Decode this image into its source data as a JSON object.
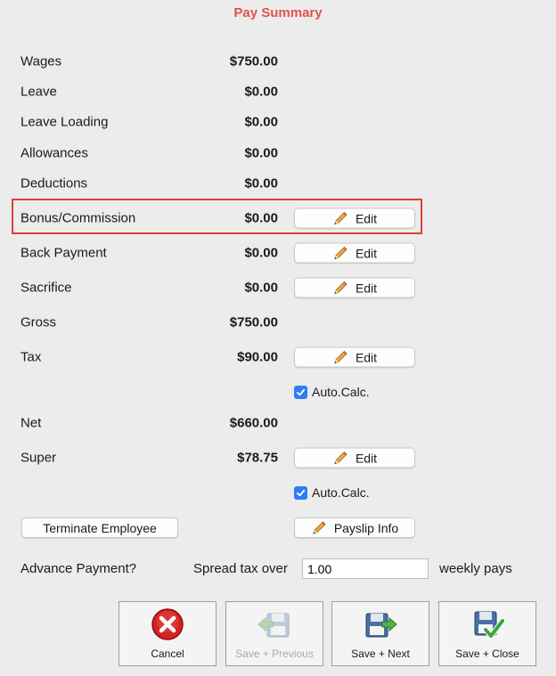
{
  "title": "Pay Summary",
  "rows": [
    {
      "label": "Wages",
      "amount": "$750.00"
    },
    {
      "label": "Leave",
      "amount": "$0.00"
    },
    {
      "label": "Leave Loading",
      "amount": "$0.00"
    },
    {
      "label": "Allowances",
      "amount": "$0.00"
    },
    {
      "label": "Deductions",
      "amount": "$0.00"
    },
    {
      "label": "Bonus/Commission",
      "amount": "$0.00"
    },
    {
      "label": "Back Payment",
      "amount": "$0.00"
    },
    {
      "label": "Sacrifice",
      "amount": "$0.00"
    },
    {
      "label": "Gross",
      "amount": "$750.00"
    },
    {
      "label": "Tax",
      "amount": "$90.00"
    },
    {
      "label": "Net",
      "amount": "$660.00"
    },
    {
      "label": "Super",
      "amount": "$78.75"
    }
  ],
  "edit_label": "Edit",
  "auto_calc_label": "Auto.Calc.",
  "tax_auto_calc_checked": true,
  "super_auto_calc_checked": true,
  "terminate_label": "Terminate Employee",
  "payslip_label": "Payslip Info",
  "advance": {
    "label": "Advance Payment?",
    "spread_label": "Spread tax over",
    "spread_value": "1.00",
    "suffix": "weekly pays"
  },
  "buttons": {
    "cancel": "Cancel",
    "save_previous": "Save + Previous",
    "save_next": "Save + Next",
    "save_close": "Save + Close"
  },
  "colors": {
    "title": "#e2524a",
    "highlight": "#d9422f",
    "checkbox": "#2f7cf6"
  },
  "icons": {
    "edit": "pencil-icon",
    "cancel": "cancel-x-icon",
    "save_previous": "save-previous-icon",
    "save_next": "save-next-icon",
    "save_close": "save-close-icon"
  }
}
